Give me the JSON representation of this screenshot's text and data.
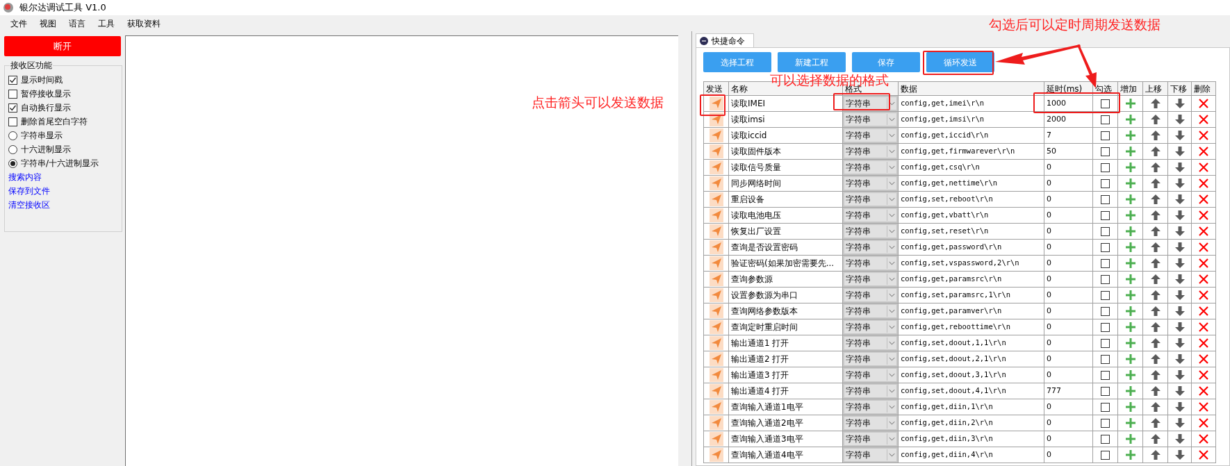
{
  "window": {
    "title": "银尔达调试工具 V1.0"
  },
  "menu": [
    "文件",
    "视图",
    "语言",
    "工具",
    "获取资料"
  ],
  "left_panel": {
    "connect_button": "断开",
    "group_title": "接收区功能",
    "options": [
      {
        "kind": "checkbox",
        "label": "显示时间戳",
        "checked": true
      },
      {
        "kind": "checkbox",
        "label": "暂停接收显示",
        "checked": false
      },
      {
        "kind": "checkbox",
        "label": "自动换行显示",
        "checked": true
      },
      {
        "kind": "checkbox",
        "label": "删除首尾空白字符",
        "checked": false
      },
      {
        "kind": "radio",
        "label": "字符串显示",
        "selected": false
      },
      {
        "kind": "radio",
        "label": "十六进制显示",
        "selected": false
      },
      {
        "kind": "radio",
        "label": "字符串/十六进制显示",
        "selected": true
      }
    ],
    "links": [
      "搜索内容",
      "保存到文件",
      "清空接收区"
    ]
  },
  "quick_commands": {
    "tab": "快捷命令",
    "buttons": [
      "选择工程",
      "新建工程",
      "保存",
      "循环发送"
    ],
    "columns": [
      "发送",
      "名称",
      "格式",
      "数据",
      "延时(ms)",
      "勾选",
      "增加",
      "上移",
      "下移",
      "删除"
    ],
    "rows": [
      {
        "name": "读取IMEI",
        "format": "字符串",
        "data": "config,get,imei\\r\\n",
        "delay": "1000",
        "checked": false
      },
      {
        "name": "读取imsi",
        "format": "字符串",
        "data": "config,get,imsi\\r\\n",
        "delay": "2000",
        "checked": false
      },
      {
        "name": "读取iccid",
        "format": "字符串",
        "data": "config,get,iccid\\r\\n",
        "delay": "7",
        "checked": false
      },
      {
        "name": "读取固件版本",
        "format": "字符串",
        "data": "config,get,firmwarever\\r\\n",
        "delay": "50",
        "checked": false
      },
      {
        "name": "读取信号质量",
        "format": "字符串",
        "data": "config,get,csq\\r\\n",
        "delay": "0",
        "checked": false
      },
      {
        "name": "同步网络时间",
        "format": "字符串",
        "data": "config,get,nettime\\r\\n",
        "delay": "0",
        "checked": false
      },
      {
        "name": "重启设备",
        "format": "字符串",
        "data": "config,set,reboot\\r\\n",
        "delay": "0",
        "checked": false
      },
      {
        "name": "读取电池电压",
        "format": "字符串",
        "data": "config,get,vbatt\\r\\n",
        "delay": "0",
        "checked": false
      },
      {
        "name": "恢复出厂设置",
        "format": "字符串",
        "data": "config,set,reset\\r\\n",
        "delay": "0",
        "checked": false
      },
      {
        "name": "查询是否设置密码",
        "format": "字符串",
        "data": "config,get,password\\r\\n",
        "delay": "0",
        "checked": false
      },
      {
        "name": "验证密码(如果加密需要先...",
        "format": "字符串",
        "data": "config,set,vspassword,2\\r\\n",
        "delay": "0",
        "checked": false
      },
      {
        "name": "查询参数源",
        "format": "字符串",
        "data": "config,get,paramsrc\\r\\n",
        "delay": "0",
        "checked": false
      },
      {
        "name": "设置参数源为串口",
        "format": "字符串",
        "data": "config,set,paramsrc,1\\r\\n",
        "delay": "0",
        "checked": false
      },
      {
        "name": "查询网络参数版本",
        "format": "字符串",
        "data": "config,get,paramver\\r\\n",
        "delay": "0",
        "checked": false
      },
      {
        "name": "查询定时重启时间",
        "format": "字符串",
        "data": "config,get,reboottime\\r\\n",
        "delay": "0",
        "checked": false
      },
      {
        "name": "输出通道1 打开",
        "format": "字符串",
        "data": "config,set,doout,1,1\\r\\n",
        "delay": "0",
        "checked": false
      },
      {
        "name": "输出通道2 打开",
        "format": "字符串",
        "data": "config,set,doout,2,1\\r\\n",
        "delay": "0",
        "checked": false
      },
      {
        "name": "输出通道3 打开",
        "format": "字符串",
        "data": "config,set,doout,3,1\\r\\n",
        "delay": "0",
        "checked": false
      },
      {
        "name": "输出通道4 打开",
        "format": "字符串",
        "data": "config,set,doout,4,1\\r\\n",
        "delay": "777",
        "checked": false
      },
      {
        "name": "查询输入通道1电平",
        "format": "字符串",
        "data": "config,get,diin,1\\r\\n",
        "delay": "0",
        "checked": false
      },
      {
        "name": "查询输入通道2电平",
        "format": "字符串",
        "data": "config,get,diin,2\\r\\n",
        "delay": "0",
        "checked": false
      },
      {
        "name": "查询输入通道3电平",
        "format": "字符串",
        "data": "config,get,diin,3\\r\\n",
        "delay": "0",
        "checked": false
      },
      {
        "name": "查询输入通道4电平",
        "format": "字符串",
        "data": "config,get,diin,4\\r\\n",
        "delay": "0",
        "checked": false
      }
    ]
  },
  "annotations": [
    "点击箭头可以发送数据",
    "可以选择数据的格式",
    "勾选后可以定时周期发送数据"
  ]
}
